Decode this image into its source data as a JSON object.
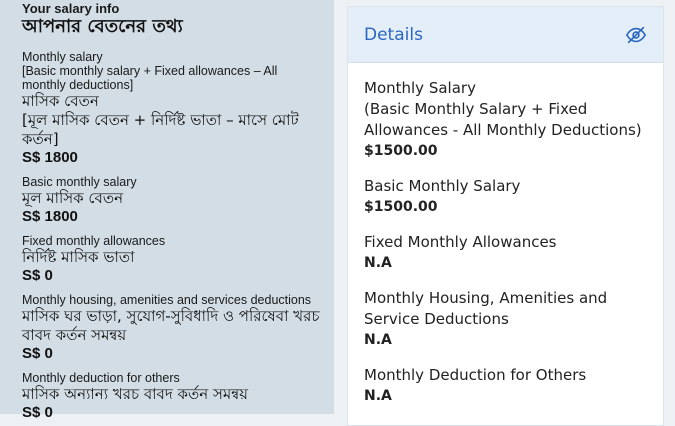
{
  "left": {
    "title_en": "Your salary info",
    "title_bn": "আপনার বেতনের তথ্য",
    "items": [
      {
        "en": "Monthly salary",
        "en_sub": "[Basic monthly salary + Fixed allowances – All monthly deductions]",
        "bn": "মাসিক বেতন",
        "bn_sub": "[মূল মাসিক বেতন + নির্দিষ্ট ভাতা – মাসে মোট কর্তন]",
        "value": "S$ 1800"
      },
      {
        "en": "Basic monthly salary",
        "bn": "মূল মাসিক বেতন",
        "value": "S$ 1800"
      },
      {
        "en": "Fixed monthly allowances",
        "bn": "নির্দিষ্ট মাসিক ভাতা",
        "value": "S$ 0"
      },
      {
        "en": "Monthly housing, amenities and services deductions",
        "bn": "মাসিক ঘর ভাড়া, সুযোগ-সুবিধাদি ও পরিষেবা খরচ বাবদ কর্তন সমন্বয়",
        "value": "S$ 0"
      },
      {
        "en": "Monthly deduction for others",
        "bn": "মাসিক অন্যান্য খরচ বাবদ কর্তন সমন্বয়",
        "value": "S$ 0"
      }
    ]
  },
  "details": {
    "title": "Details",
    "toggle_icon": "eye-slash-icon",
    "accent_color": "#2a66c2",
    "items": [
      {
        "label": "Monthly Salary",
        "sub": "(Basic Monthly Salary + Fixed Allowances - All Monthly Deductions)",
        "value": "$1500.00"
      },
      {
        "label": "Basic Monthly Salary",
        "value": "$1500.00"
      },
      {
        "label": "Fixed Monthly Allowances",
        "value": "N.A"
      },
      {
        "label": "Monthly Housing, Amenities and Service Deductions",
        "value": "N.A"
      },
      {
        "label": "Monthly Deduction for Others",
        "value": "N.A"
      }
    ]
  }
}
